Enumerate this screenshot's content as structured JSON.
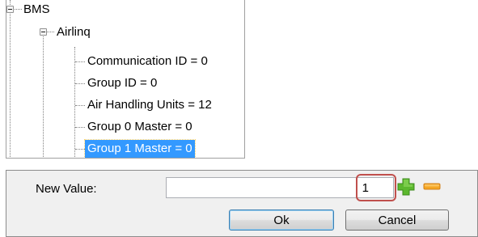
{
  "tree": {
    "root": {
      "label": "BMS"
    },
    "child": {
      "label": "Airlinq"
    },
    "properties": [
      {
        "label": "Communication ID = 0",
        "selected": false
      },
      {
        "label": "Group ID = 0",
        "selected": false
      },
      {
        "label": "Air Handling Units = 12",
        "selected": false
      },
      {
        "label": "Group 0 Master  = 0",
        "selected": false
      },
      {
        "label": "Group 1 Master = 0",
        "selected": true
      }
    ]
  },
  "dialog": {
    "field_label": "New Value:",
    "value": "1",
    "increment_icon": "plus-icon",
    "decrement_icon": "minus-icon",
    "highlight_color": "#c0504d",
    "ok_label": "Ok",
    "cancel_label": "Cancel"
  },
  "colors": {
    "selection": "#3399ff",
    "plus": "#5cb82e",
    "minus": "#f5a623"
  }
}
